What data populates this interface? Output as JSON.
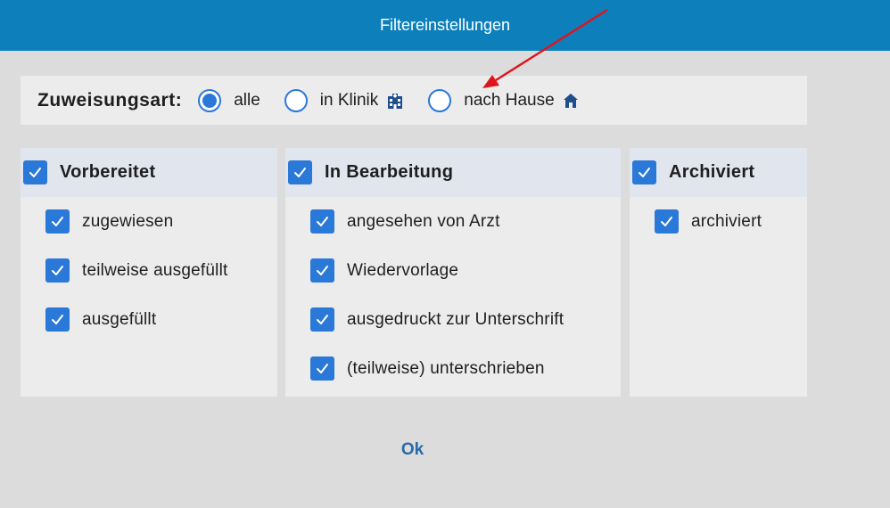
{
  "dialog": {
    "title": "Filtereinstellungen"
  },
  "assignment": {
    "label": "Zuweisungsart:",
    "options": [
      {
        "label": "alle",
        "selected": true,
        "icon": null
      },
      {
        "label": "in Klinik",
        "selected": false,
        "icon": "hospital-icon"
      },
      {
        "label": "nach Hause",
        "selected": false,
        "icon": "home-icon"
      }
    ]
  },
  "panels": [
    {
      "title": "Vorbereitet",
      "checked": true,
      "items": [
        {
          "label": "zugewiesen",
          "checked": true
        },
        {
          "label": "teilweise ausgefüllt",
          "checked": true
        },
        {
          "label": "ausgefüllt",
          "checked": true
        }
      ]
    },
    {
      "title": "In Bearbeitung",
      "checked": true,
      "items": [
        {
          "label": "angesehen von Arzt",
          "checked": true
        },
        {
          "label": "Wiedervorlage",
          "checked": true
        },
        {
          "label": "ausgedruckt zur Unterschrift",
          "checked": true
        },
        {
          "label": "(teilweise) unterschrieben",
          "checked": true
        }
      ]
    },
    {
      "title": "Archiviert",
      "checked": true,
      "items": [
        {
          "label": "archiviert",
          "checked": true
        }
      ]
    }
  ],
  "actions": {
    "ok_label": "Ok"
  },
  "colors": {
    "header": "#0d80bb",
    "accent": "#2a78d8",
    "annotation_arrow": "#e0141c",
    "icon": "#1f4e8c"
  }
}
